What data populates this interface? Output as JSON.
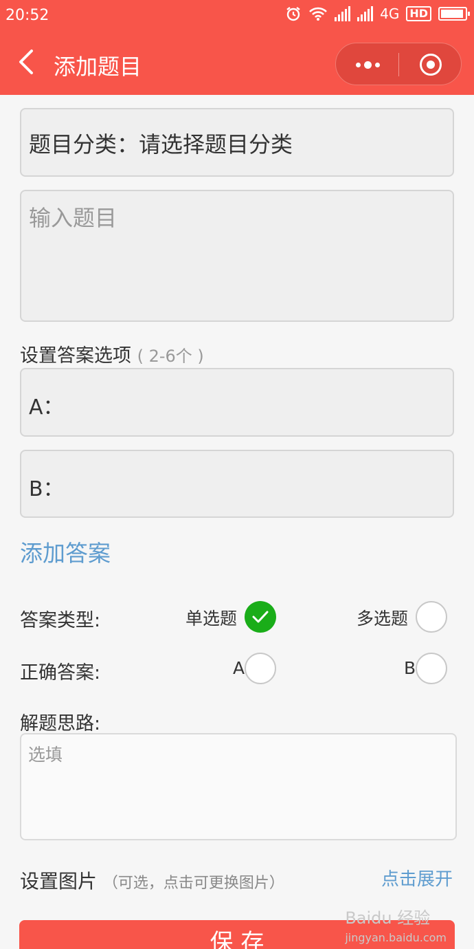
{
  "status": {
    "time": "20:52",
    "network": "4G",
    "hd": "HD"
  },
  "nav": {
    "title": "添加题目"
  },
  "form": {
    "category_text": "题目分类：请选择题目分类",
    "question_placeholder": "输入题目",
    "options_label": "设置答案选项",
    "options_hint": "( 2-6个 )",
    "options": [
      {
        "label": "A："
      },
      {
        "label": "B："
      }
    ],
    "add_answer": "添加答案",
    "answer_type_label": "答案类型:",
    "single_choice": "单选题",
    "multi_choice": "多选题",
    "correct_label": "正确答案:",
    "correct_a": "A",
    "correct_b": "B",
    "explanation_label": "解题思路:",
    "explanation_placeholder": "选填",
    "image_label": "设置图片",
    "image_hint": "（可选，点击可更换图片）",
    "expand_link": "点击展开",
    "save": "保 存"
  },
  "watermark": {
    "brand": "Baidu 经验",
    "url": "jingyan.baidu.com"
  },
  "colors": {
    "primary": "#f8554a",
    "link": "#5e9ccf",
    "check": "#1aad19"
  }
}
